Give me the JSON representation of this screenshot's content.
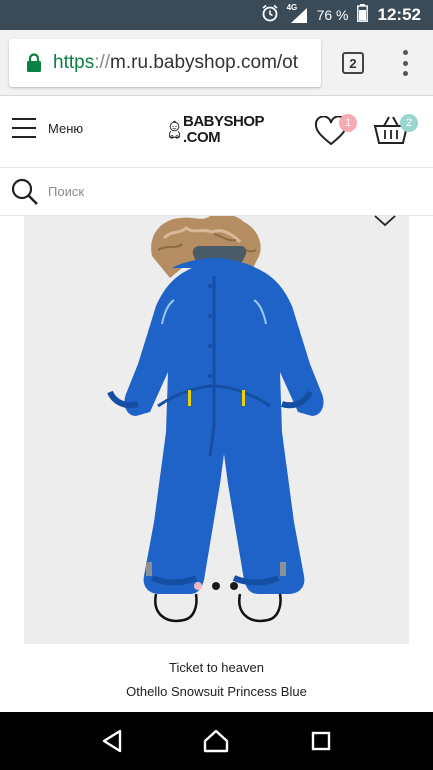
{
  "status_bar": {
    "network": "4G",
    "battery": "76 %",
    "time": "12:52"
  },
  "browser": {
    "url_scheme": "https",
    "url_separator": "://",
    "url_host": "m.ru.babyshop.com/ot",
    "tab_count": "2"
  },
  "header": {
    "menu_label": "Меню",
    "logo_line1": "BABYSHOP",
    "logo_line2": ".COM",
    "wishlist_count": "1",
    "cart_count": "2"
  },
  "search": {
    "placeholder": "Поиск"
  },
  "product": {
    "brand": "Ticket to heaven",
    "title": "Othello Snowsuit Princess Blue",
    "image_count": 3,
    "active_image": 1
  },
  "colors": {
    "status_bar": "#3a4a56",
    "url_scheme": "#0b8043",
    "wishlist_badge": "#f5a9b2",
    "cart_badge": "#9ad6cf",
    "suit_blue": "#1f63c9"
  },
  "icons": {
    "lock": "lock-icon",
    "menu": "hamburger-icon",
    "wishlist": "heart-icon",
    "cart": "basket-icon",
    "search": "search-icon",
    "nav_back": "back-triangle-icon",
    "nav_home": "home-icon",
    "nav_recents": "recents-square-icon"
  }
}
